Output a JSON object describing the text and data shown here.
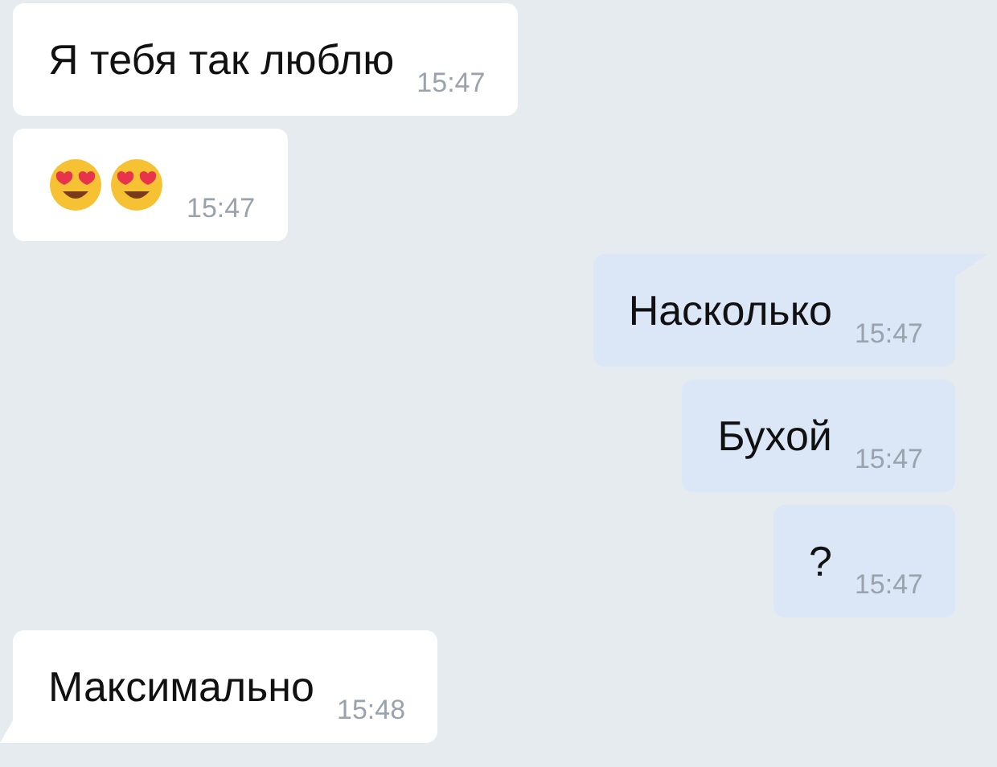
{
  "messages": [
    {
      "kind": "text",
      "outgoing": false,
      "tail": false,
      "text": "Я тебя так люблю",
      "time": "15:47"
    },
    {
      "kind": "emoji",
      "outgoing": false,
      "tail": false,
      "emojis": [
        {
          "kind": "heart-eyes"
        },
        {
          "kind": "heart-eyes"
        }
      ],
      "time": "15:47"
    },
    {
      "kind": "text",
      "outgoing": true,
      "tail": true,
      "text": "Насколько",
      "time": "15:47"
    },
    {
      "kind": "text",
      "outgoing": true,
      "tail": false,
      "text": "Бухой",
      "time": "15:47"
    },
    {
      "kind": "text",
      "outgoing": true,
      "tail": false,
      "text": "?",
      "time": "15:47"
    },
    {
      "kind": "text",
      "outgoing": false,
      "tail": true,
      "text": "Максимально",
      "time": "15:48"
    }
  ]
}
